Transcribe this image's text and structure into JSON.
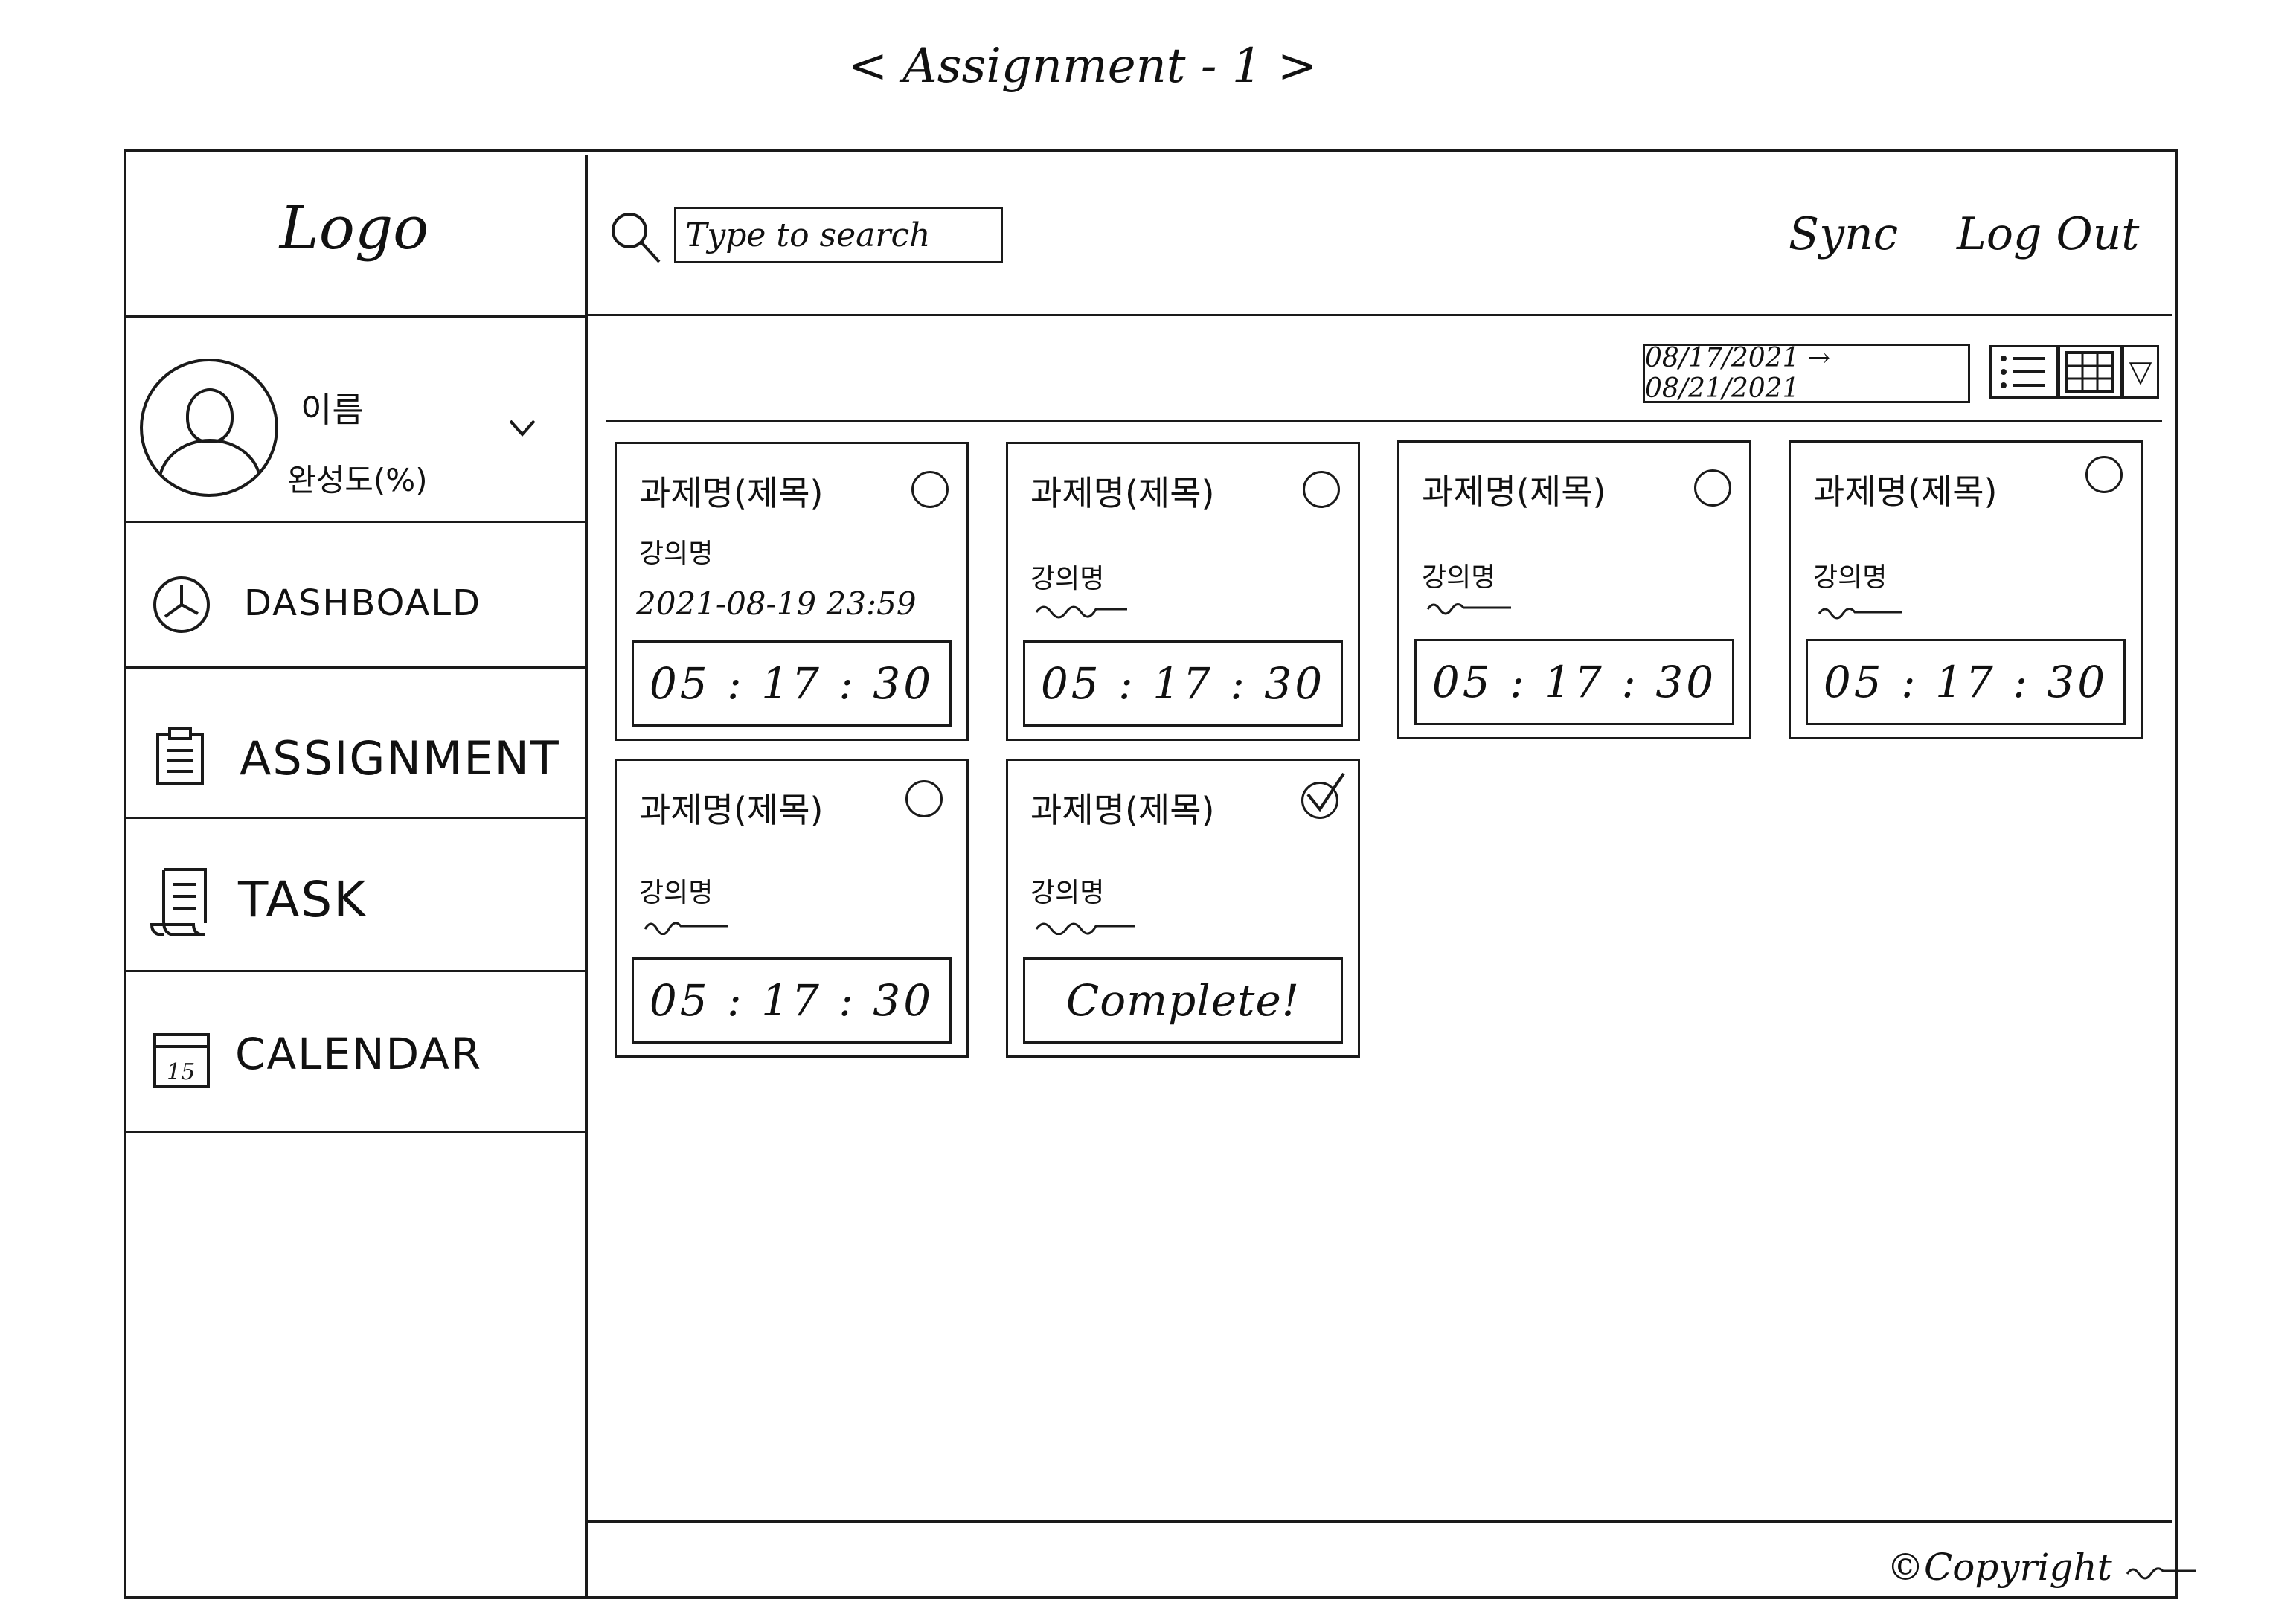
{
  "page_title": "< Assignment - 1 >",
  "sidebar": {
    "logo": "Logo",
    "profile": {
      "name": "이름",
      "progress": "완성도(%)"
    },
    "items": [
      {
        "label": "DASHBOALD",
        "icon": "pie-chart-icon"
      },
      {
        "label": "ASSIGNMENT",
        "icon": "clipboard-icon"
      },
      {
        "label": "TASK",
        "icon": "scroll-icon"
      },
      {
        "label": "CALENDAR",
        "icon": "calendar-icon",
        "icon_text": "15"
      }
    ]
  },
  "header": {
    "search_placeholder": "Type to search",
    "sync": "Sync",
    "logout": "Log Out"
  },
  "filter": {
    "date_range": "08/17/2021 → 08/21/2021",
    "filter_caret": "▽"
  },
  "cards": [
    {
      "title": "과제명(제목)",
      "course": "강의명",
      "due": "2021-08-19 23:59",
      "timer": "05 : 17 : 30",
      "completed": false
    },
    {
      "title": "과제명(제목)",
      "course": "강의명",
      "timer": "05 : 17 : 30",
      "completed": false
    },
    {
      "title": "과제명(제목)",
      "course": "강의명",
      "timer": "05 : 17 : 30",
      "completed": false
    },
    {
      "title": "과제명(제목)",
      "course": "강의명",
      "timer": "05 : 17 : 30",
      "completed": false
    },
    {
      "title": "과제명(제목)",
      "course": "강의명",
      "timer": "05 : 17 : 30",
      "completed": false
    },
    {
      "title": "과제명(제목)",
      "course": "강의명",
      "timer": "Complete!",
      "completed": true
    }
  ],
  "footer": {
    "copyright": "©Copyright"
  }
}
